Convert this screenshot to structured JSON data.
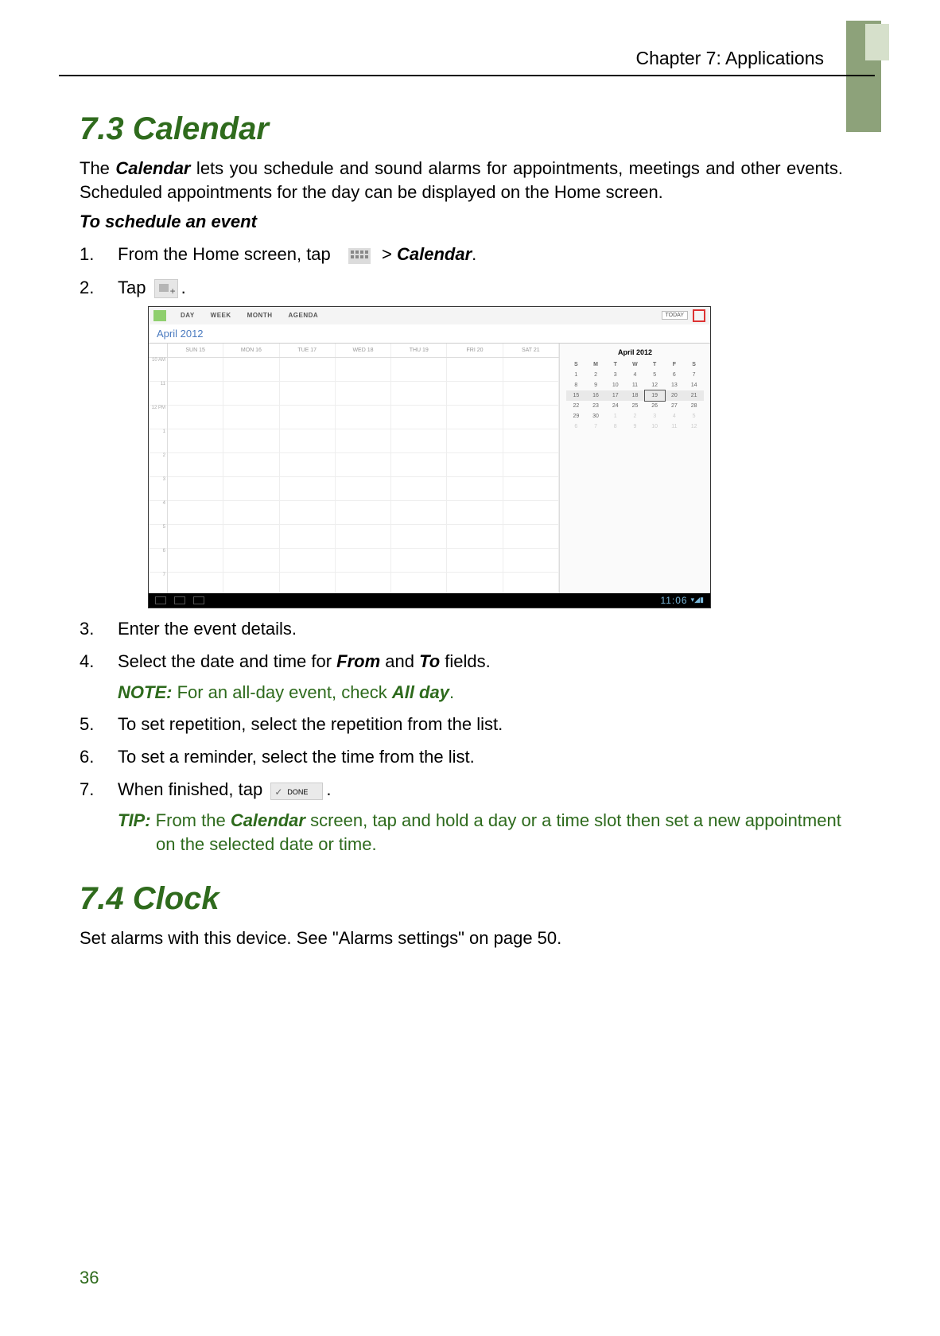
{
  "header": {
    "chapter": "Chapter 7: Applications"
  },
  "section1": {
    "heading": "7.3 Calendar",
    "intro_pre": "The ",
    "intro_app": "Calendar",
    "intro_post": " lets you schedule and sound alarms for appointments, meetings and other events. Scheduled appointments for the day can be displayed on the Home screen.",
    "sub": "To schedule an event",
    "step1_pre": "From the Home screen, tap ",
    "step1_mid": " > ",
    "step1_app": "Calendar",
    "step1_end": ".",
    "step2_pre": "Tap ",
    "step2_end": ".",
    "step3": "Enter the event details.",
    "step4_pre": "Select the date and time for ",
    "step4_from": "From",
    "step4_mid": " and ",
    "step4_to": "To",
    "step4_end": " fields.",
    "note_label": "NOTE:",
    "note_body_pre": " For an all-day event, check ",
    "note_body_bold": "All day",
    "note_body_end": ".",
    "step5": "To set repetition, select the repetition from the list.",
    "step6": "To set a reminder, select the time from the list.",
    "step7_pre": "When finished, tap ",
    "step7_end": ".",
    "tip_label": "TIP:",
    "tip_body_pre": " From the ",
    "tip_body_app": "Calendar",
    "tip_body_post": " screen, tap and hold a day or a time slot then set a new appointment on the selected date or time."
  },
  "screenshot": {
    "tabs": [
      "DAY",
      "WEEK",
      "MONTH",
      "AGENDA"
    ],
    "today_label": "TODAY",
    "month_label": "April 2012",
    "mini_month_label": "April 2012",
    "days_header": [
      "SUN 15",
      "MON 16",
      "TUE 17",
      "WED 18",
      "THU 19",
      "FRI 20",
      "SAT 21"
    ],
    "hours": [
      "10 AM",
      "11",
      "12 PM",
      "1",
      "2",
      "3",
      "4",
      "5",
      "6",
      "7"
    ],
    "mini_dow": [
      "S",
      "M",
      "T",
      "W",
      "T",
      "F",
      "S"
    ],
    "mini_rows": [
      [
        "1",
        "2",
        "3",
        "4",
        "5",
        "6",
        "7"
      ],
      [
        "8",
        "9",
        "10",
        "11",
        "12",
        "13",
        "14"
      ],
      [
        "15",
        "16",
        "17",
        "18",
        "19",
        "20",
        "21"
      ],
      [
        "22",
        "23",
        "24",
        "25",
        "26",
        "27",
        "28"
      ],
      [
        "29",
        "30",
        "1",
        "2",
        "3",
        "4",
        "5"
      ],
      [
        "6",
        "7",
        "8",
        "9",
        "10",
        "11",
        "12"
      ]
    ],
    "clock_time": "11:06",
    "signal": "▾◢▮"
  },
  "section2": {
    "heading": "7.4 Clock",
    "body_pre": "Set alarms with this device. See \"Alarms settings\" on page ",
    "page_ref": "50",
    "body_end": "."
  },
  "page_number": "36",
  "done_label": "DONE"
}
